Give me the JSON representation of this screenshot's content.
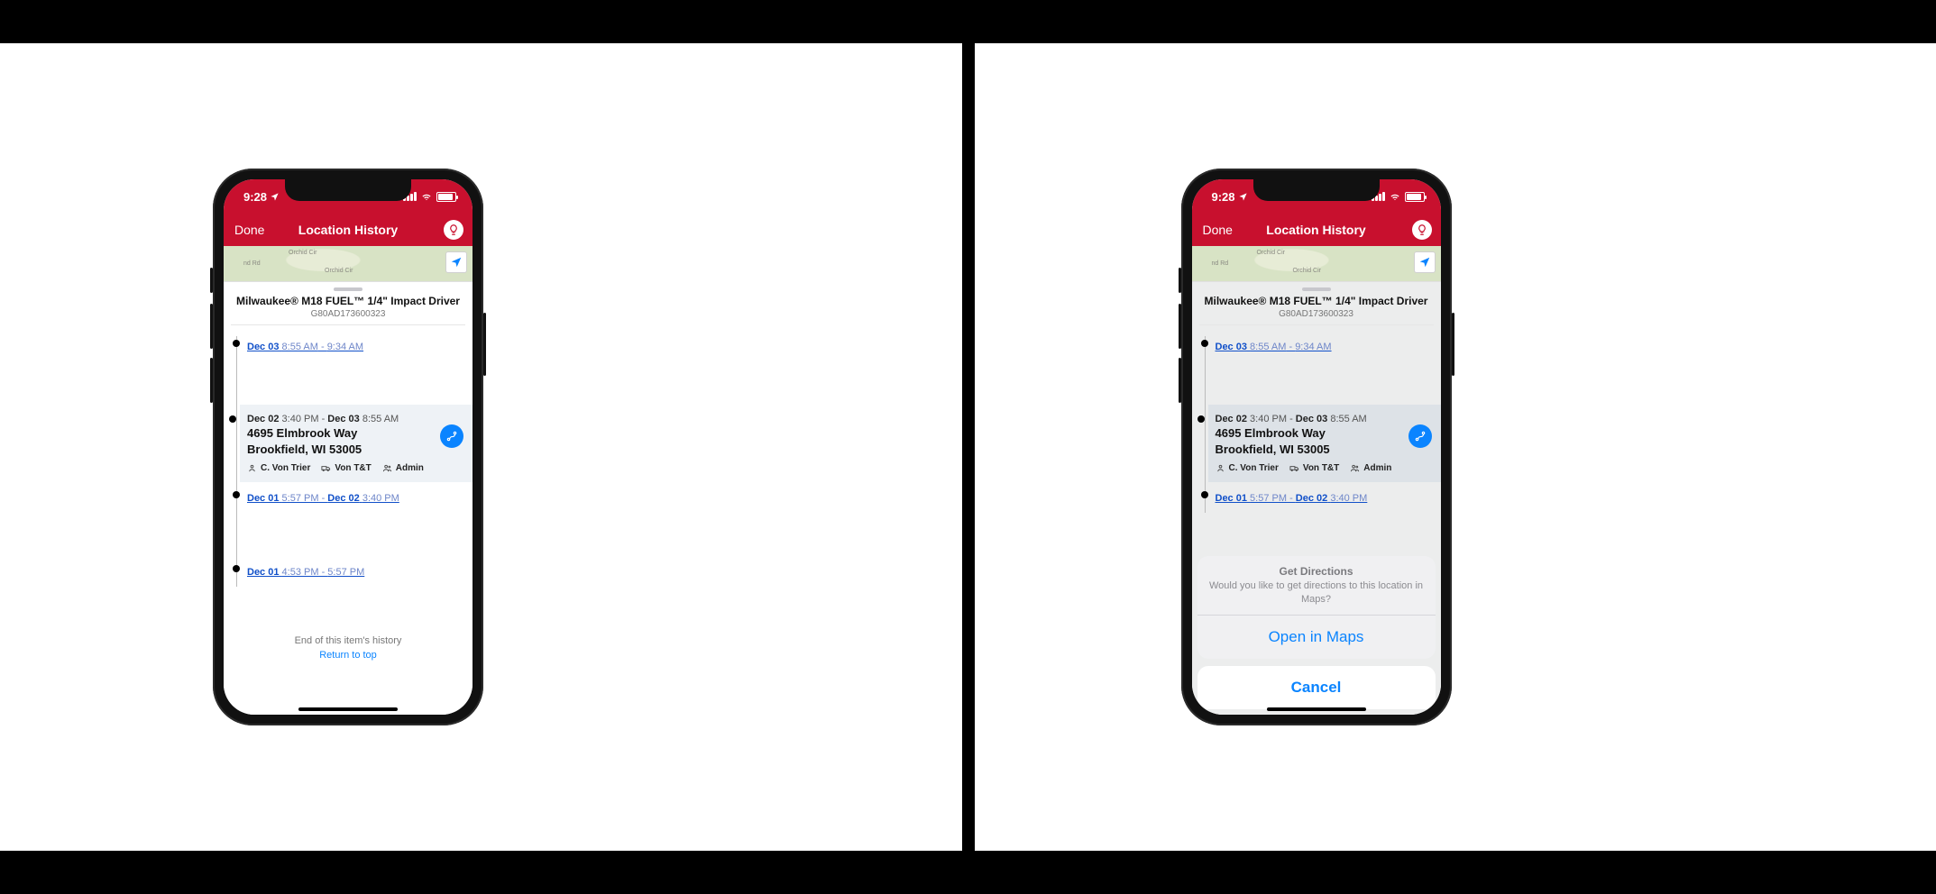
{
  "status": {
    "time": "9:28",
    "loc_icon": "location-arrow"
  },
  "nav": {
    "done": "Done",
    "title": "Location History"
  },
  "map": {
    "label1": "Orchid Cir",
    "label2": "Orchid Cir",
    "street": "nd Rd"
  },
  "tool": {
    "title": "Milwaukee® M18 FUEL™ 1/4\" Impact Driver",
    "serial": "G80AD173600323"
  },
  "timeline": {
    "items": [
      {
        "type": "link",
        "d1": "Dec 03",
        "t1": "8:55 AM",
        "t2": "9:34 AM"
      },
      {
        "type": "expanded",
        "d1": "Dec 02",
        "t1": "3:40 PM",
        "d2": "Dec 03",
        "t2": "8:55 AM",
        "addr1": "4695 Elmbrook Way",
        "addr2": "Brookfield, WI 53005",
        "meta": [
          {
            "icon": "assignee",
            "text": "C. Von Trier"
          },
          {
            "icon": "division",
            "text": "Von T&T"
          },
          {
            "icon": "admin",
            "text": "Admin"
          }
        ]
      },
      {
        "type": "link2",
        "d1": "Dec 01",
        "t1": "5:57 PM",
        "d2": "Dec 02",
        "t2": "3:40 PM"
      },
      {
        "type": "link",
        "d1": "Dec 01",
        "t1": "4:53 PM",
        "t2": "5:57 PM"
      }
    ]
  },
  "end": {
    "text": "End of this item's history",
    "return": "Return to top"
  },
  "actionsheet": {
    "title": "Get Directions",
    "message": "Would you like to get directions to this location in Maps?",
    "open": "Open in Maps",
    "cancel": "Cancel"
  }
}
